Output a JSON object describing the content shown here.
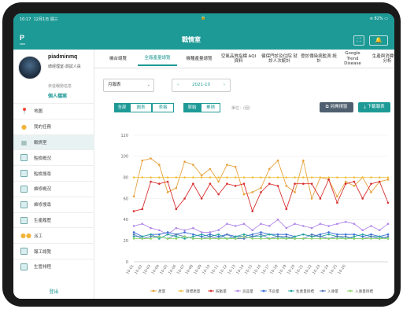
{
  "status": {
    "time": "10:17",
    "date": "12月1日 週三",
    "battery": "82%"
  },
  "app": {
    "logo": "P",
    "logo_sub": "SMIS",
    "title": "戰情室",
    "fullscreen_glyph": "⛶",
    "bell_glyph": "🔔"
  },
  "user": {
    "name": "piadminmq",
    "role": "總經理室-測試人員",
    "status": "未從戰勢信息",
    "profile_link": "個人檔案"
  },
  "menu": [
    {
      "label": "地圖",
      "icon": "map-pin-icon"
    },
    {
      "label": "我的任務",
      "icon": "person-icon"
    },
    {
      "label": "戰情室",
      "icon": "dashboard-icon",
      "active": true
    },
    {
      "label": "點檢概況",
      "icon": "checklist-icon"
    },
    {
      "label": "點檢搜尋",
      "icon": "checklist-search-icon"
    },
    {
      "label": "維修概況",
      "icon": "repair-icon"
    },
    {
      "label": "維修搜尋",
      "icon": "repair-search-icon"
    },
    {
      "label": "生產履歷",
      "icon": "production-icon"
    },
    {
      "label": "派工",
      "icon": "people-icon"
    },
    {
      "label": "報工總覽",
      "icon": "report-icon"
    },
    {
      "label": "生管排程",
      "icon": "schedule-icon"
    }
  ],
  "logout": "登出",
  "tabs": [
    {
      "label": "機台總覽"
    },
    {
      "label": "全廠產量總覽",
      "active": true
    },
    {
      "label": "機種產量總覽"
    },
    {
      "label": "空氣品質指標 AQI資料"
    },
    {
      "label": "健保門診及住院 就診人次統計"
    },
    {
      "label": "登診傳染病監測 統計"
    },
    {
      "label": "Google Trend Disease"
    },
    {
      "label": "生產與消費數據 分析"
    }
  ],
  "filters": {
    "period": "月報表",
    "date": "2021-10",
    "prev": "‹",
    "next": "›",
    "caret": "⌄"
  },
  "chart_type_tabs": [
    "全部",
    "圖表",
    "表格"
  ],
  "mode_tabs": [
    "原始",
    "累積"
  ],
  "unit_label": "單位：(個)",
  "actions": {
    "save_as": "另開視窗",
    "download": "下載報表"
  },
  "chart_data": {
    "type": "line",
    "x": [
      "10-01",
      "10-02",
      "10-03",
      "10-04",
      "10-05",
      "10-06",
      "10-07",
      "10-08",
      "10-09",
      "10-10",
      "10-11",
      "10-12",
      "10-13",
      "10-14",
      "10-15",
      "10-16",
      "10-17",
      "10-18",
      "10-19",
      "10-20",
      "10-21",
      "10-22",
      "10-23",
      "10-24",
      "10-25",
      "10-26",
      "10-27",
      "10-28",
      "10-29",
      "10-30",
      "10-31"
    ],
    "x_tick_labels": [
      "10-01",
      "10-02",
      "10-03",
      "10-04",
      "10-05",
      "10-06",
      "10-07",
      "10-08",
      "10-09",
      "10-10",
      "10-11",
      "10-12",
      "10-13",
      "10-14",
      "10-15",
      "10-16",
      "10-17",
      "10-18",
      "10-19",
      "10-20",
      "10-21",
      "10-22",
      "10-23",
      "10-24",
      "10-25",
      "10-26"
    ],
    "ylim": [
      0,
      120
    ],
    "yticks": [
      0,
      20,
      40,
      60,
      80,
      100,
      120
    ],
    "grid": true,
    "legend_position": "bottom",
    "series": [
      {
        "name": "產量",
        "color": "#e6a23c",
        "values": [
          62,
          96,
          98,
          92,
          66,
          70,
          95,
          92,
          82,
          88,
          76,
          92,
          90,
          64,
          66,
          70,
          88,
          96,
          72,
          66,
          96,
          60,
          80,
          78,
          62,
          76,
          72,
          80,
          66,
          76,
          78
        ]
      },
      {
        "name": "目標產量",
        "color": "#f0c040",
        "values": [
          80,
          80,
          80,
          80,
          80,
          80,
          80,
          80,
          80,
          80,
          80,
          80,
          80,
          80,
          80,
          80,
          80,
          80,
          80,
          80,
          80,
          80,
          80,
          80,
          80,
          80,
          80,
          80,
          80,
          80,
          80
        ]
      },
      {
        "name": "稼動量",
        "color": "#d93030",
        "values": [
          48,
          50,
          76,
          74,
          76,
          50,
          60,
          74,
          60,
          74,
          64,
          74,
          72,
          74,
          48,
          66,
          74,
          72,
          50,
          74,
          74,
          74,
          60,
          78,
          56,
          74,
          76,
          60,
          74,
          76,
          56
        ]
      },
      {
        "name": "良品量",
        "color": "#b388e8",
        "values": [
          34,
          36,
          32,
          30,
          26,
          32,
          30,
          32,
          28,
          28,
          30,
          36,
          34,
          36,
          30,
          36,
          34,
          40,
          32,
          36,
          34,
          32,
          36,
          34,
          36,
          38,
          36,
          30,
          34,
          30,
          36
        ]
      },
      {
        "name": "不良量",
        "color": "#3a6fd8",
        "values": [
          28,
          24,
          26,
          26,
          28,
          26,
          28,
          26,
          24,
          26,
          24,
          26,
          24,
          24,
          26,
          28,
          26,
          26,
          26,
          24,
          26,
          24,
          26,
          28,
          26,
          26,
          26,
          24,
          26,
          24,
          26
        ]
      },
      {
        "name": "生產量目標",
        "color": "#2aa6a0",
        "values": [
          24,
          24,
          26,
          22,
          26,
          24,
          22,
          24,
          26,
          24,
          26,
          22,
          24,
          26,
          24,
          24,
          26,
          24,
          22,
          24,
          26,
          24,
          24,
          26,
          24,
          22,
          24,
          26,
          24,
          24,
          22
        ]
      },
      {
        "name": "入庫量",
        "color": "#5a7ab8",
        "values": [
          26,
          22,
          24,
          24,
          22,
          26,
          24,
          22,
          22,
          24,
          22,
          26,
          22,
          22,
          24,
          26,
          22,
          24,
          24,
          22,
          22,
          26,
          24,
          22,
          24,
          24,
          22,
          22,
          24,
          22,
          24
        ]
      },
      {
        "name": "入庫量目標",
        "color": "#8fd46a",
        "values": [
          22,
          22,
          22,
          24,
          22,
          22,
          24,
          22,
          22,
          22,
          22,
          22,
          22,
          24,
          22,
          22,
          22,
          22,
          22,
          22,
          22,
          22,
          22,
          22,
          22,
          22,
          22,
          22,
          22,
          22,
          22
        ]
      }
    ]
  }
}
